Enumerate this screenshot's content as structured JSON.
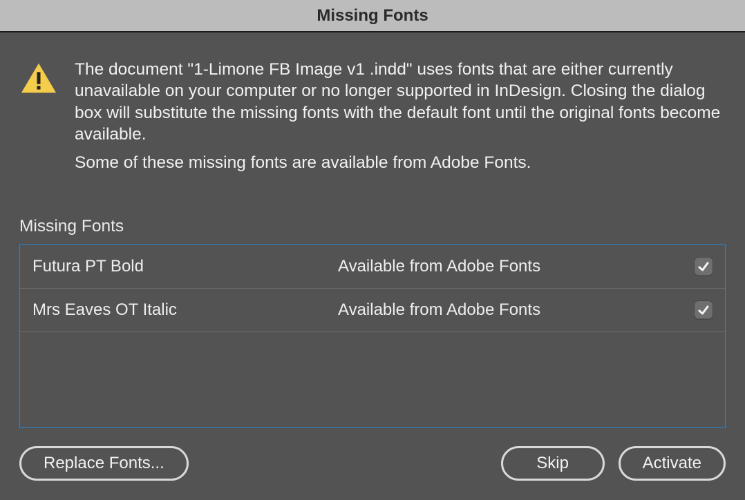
{
  "dialog": {
    "title": "Missing Fonts",
    "noticeMain": "The document \"1-Limone FB Image v1 .indd\" uses fonts that are either currently unavailable on your computer or no longer supported in InDesign. Closing the dialog box will substitute the missing fonts with the default font until the original fonts become available.",
    "noticeSub": "Some of these missing fonts are available from Adobe Fonts.",
    "sectionLabel": "Missing Fonts",
    "rows": [
      {
        "name": "Futura PT Bold",
        "status": "Available from Adobe Fonts",
        "checked": true
      },
      {
        "name": "Mrs Eaves OT Italic",
        "status": "Available from Adobe Fonts",
        "checked": true
      }
    ],
    "buttons": {
      "replace": "Replace Fonts...",
      "skip": "Skip",
      "activate": "Activate"
    }
  }
}
